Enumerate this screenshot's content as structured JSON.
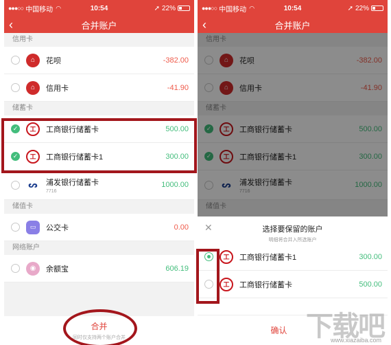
{
  "status_bar": {
    "carrier": "中国移动",
    "time": "10:54",
    "battery": "22%",
    "battery_level": 0.22
  },
  "header": {
    "title": "合并账户",
    "back_icon": "chevron-left-icon"
  },
  "sections": {
    "credit": "信用卡",
    "savings": "储蓄卡",
    "stored_value": "储值卡",
    "online": "网络账户"
  },
  "accounts": {
    "huabei": {
      "name": "花呗",
      "amount": "-382.00",
      "icon": "bank-icon"
    },
    "credit_card": {
      "name": "信用卡",
      "amount": "-41.90",
      "icon": "bank-icon"
    },
    "icbc_1": {
      "name": "工商银行储蓄卡",
      "amount": "500.00",
      "icon": "icbc-icon",
      "checked": true
    },
    "icbc_2": {
      "name": "工商银行储蓄卡1",
      "amount": "300.00",
      "icon": "icbc-icon",
      "checked": true
    },
    "spdb": {
      "name": "浦发银行储蓄卡",
      "sub": "7716",
      "amount": "1000.00",
      "icon": "spdb-icon"
    },
    "bus_card": {
      "name": "公交卡",
      "amount": "0.00",
      "icon": "card-icon"
    },
    "yuebao": {
      "name": "余额宝",
      "amount": "606.19",
      "icon": "yuebao-icon"
    }
  },
  "footer": {
    "merge_label": "合并",
    "merge_note": "同时仅支持两个账户合并"
  },
  "dialog": {
    "title": "选择要保留的账户",
    "subtitle": "明细将合并入所选账户",
    "options": [
      {
        "name": "工商银行储蓄卡1",
        "amount": "300.00",
        "selected": true
      },
      {
        "name": "工商银行储蓄卡",
        "amount": "500.00",
        "selected": false
      }
    ],
    "confirm_label": "确认"
  },
  "colors": {
    "brand": "#e0443b",
    "positive": "#43bd7c",
    "negative": "#ef5b4b",
    "highlight": "#a3161c"
  },
  "watermark": {
    "logo": "下载吧",
    "site": "www.xiazaiba.com"
  }
}
